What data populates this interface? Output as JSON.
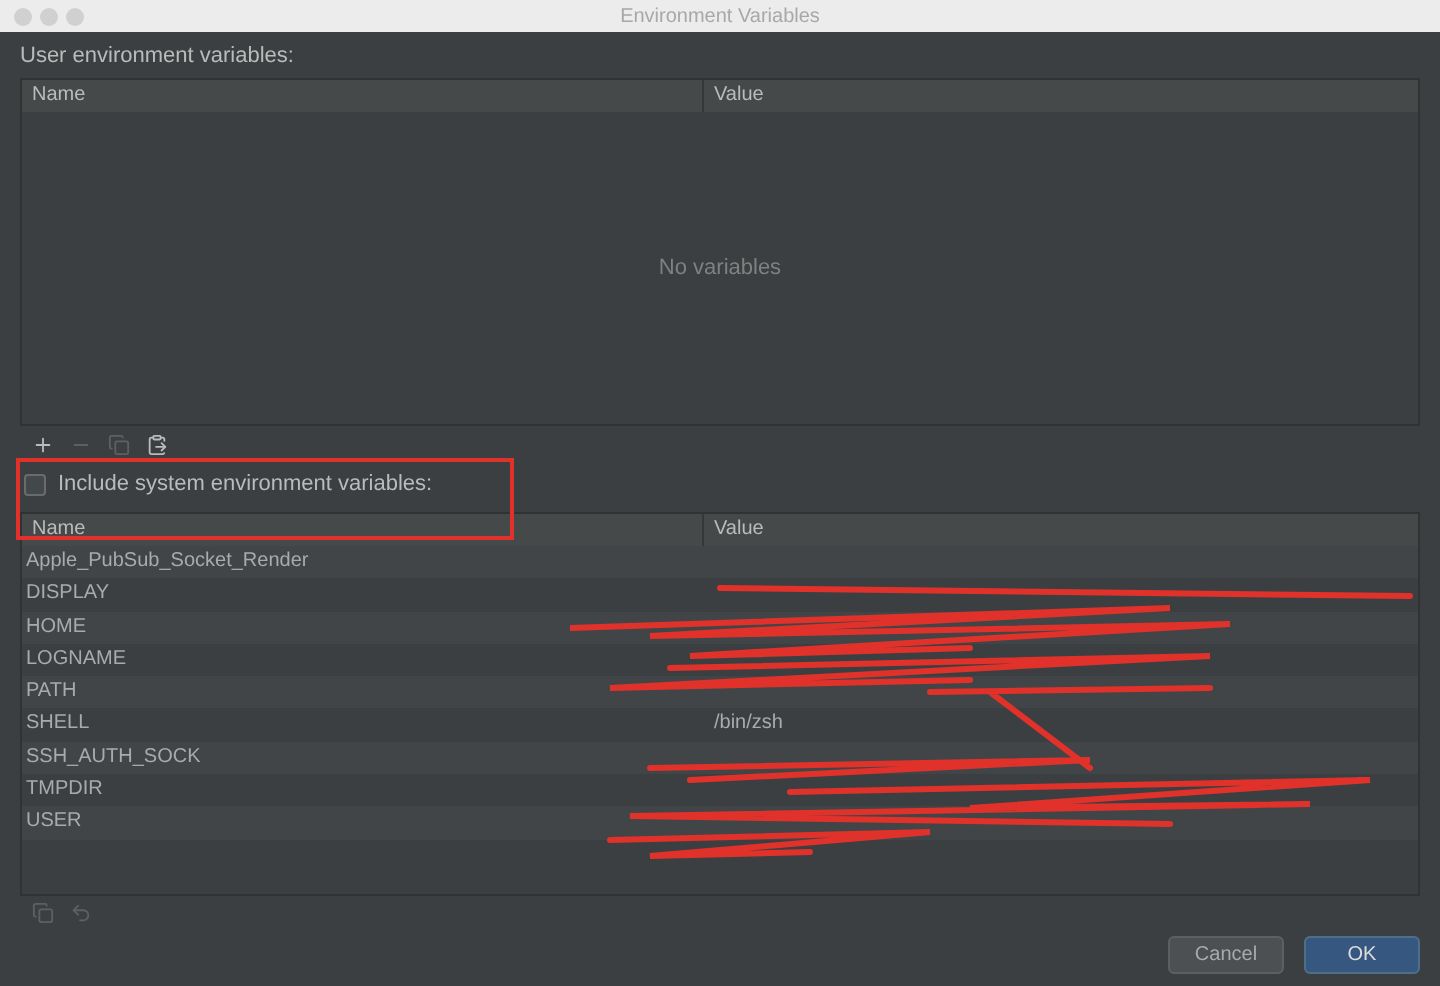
{
  "window": {
    "title": "Environment Variables"
  },
  "user_variables": {
    "label": "User environment variables:",
    "columns": [
      "Name",
      "Value"
    ],
    "empty_text": "No variables"
  },
  "include_system": {
    "label": "Include system environment variables:",
    "checked": false
  },
  "system_variables": {
    "columns": [
      "Name",
      "Value"
    ],
    "rows": [
      {
        "name": "Apple_PubSub_Socket_Render"
      },
      {
        "name": "DISPLAY"
      },
      {
        "name": "HOME"
      },
      {
        "name": "LOGNAME"
      },
      {
        "name": "PATH"
      },
      {
        "name": "SHELL",
        "value": "/bin/zsh"
      },
      {
        "name": "SSH_AUTH_SOCK"
      },
      {
        "name": "TMPDIR"
      },
      {
        "name": "USER"
      }
    ]
  },
  "buttons": [
    {
      "label": "Cancel",
      "primary": false
    },
    {
      "label": "OK",
      "primary": true
    }
  ]
}
